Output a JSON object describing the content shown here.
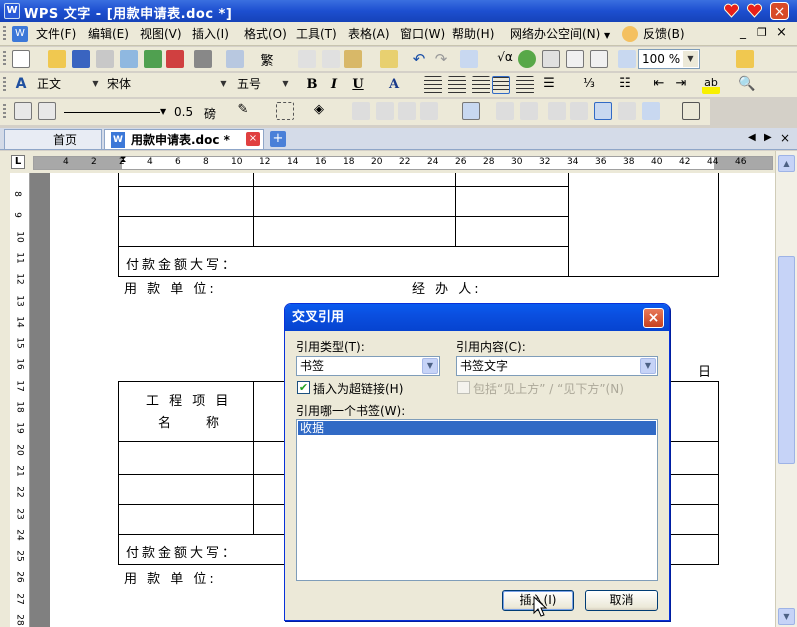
{
  "window": {
    "title": "WPS 文字 - [用款申请表.doc *]"
  },
  "menubar": {
    "items": [
      "文件(F)",
      "编辑(E)",
      "视图(V)",
      "插入(I)",
      "格式(O)",
      "工具(T)",
      "表格(A)",
      "窗口(W)",
      "帮助(H)",
      "网络办公空间(N)",
      "反馈(B)"
    ]
  },
  "toolbar": {
    "zoom": "100 %",
    "style": "正文",
    "font": "宋体",
    "size": "五号",
    "bold": "B",
    "italic": "I",
    "underline": "U",
    "line_weight": "0.5",
    "line_unit": "磅"
  },
  "tabs": {
    "home": "首页",
    "doc": "用款申请表.doc *"
  },
  "ruler": {
    "labels": [
      "4",
      "2",
      "2",
      "4",
      "6",
      "8",
      "10",
      "12",
      "14",
      "16",
      "18",
      "20",
      "22",
      "24",
      "26",
      "28",
      "30",
      "32",
      "34",
      "36",
      "38",
      "40",
      "42",
      "44",
      "46"
    ],
    "vlabels": [
      "8",
      "9",
      "10",
      "11",
      "12",
      "13",
      "14",
      "15",
      "16",
      "17",
      "18",
      "19",
      "20",
      "21",
      "22",
      "23",
      "24",
      "25",
      "26",
      "27",
      "28"
    ],
    "tab_marker": "L"
  },
  "document": {
    "amount_label_1": "付款金额大写：",
    "unit_label_1": "用 款 单 位:",
    "handler_label": "经 办 人:",
    "day_label": "日",
    "project_label_1": "工 程 项 目",
    "project_label_2": "名　　称",
    "amount_label_2": "付款金额大写：",
    "unit_label_2": "用 款 单 位:"
  },
  "dialog": {
    "title": "交叉引用",
    "ref_type_label": "引用类型(T):",
    "ref_type_value": "书签",
    "ref_content_label": "引用内容(C):",
    "ref_content_value": "书签文字",
    "hyperlink_label": "插入为超链接(H)",
    "include_label": "包括“见上方” / “见下方”(N)",
    "bookmark_list_label": "引用哪一个书签(W):",
    "bookmarks": [
      "收据"
    ],
    "insert_button": "插入(I)",
    "cancel_button": "取消"
  }
}
